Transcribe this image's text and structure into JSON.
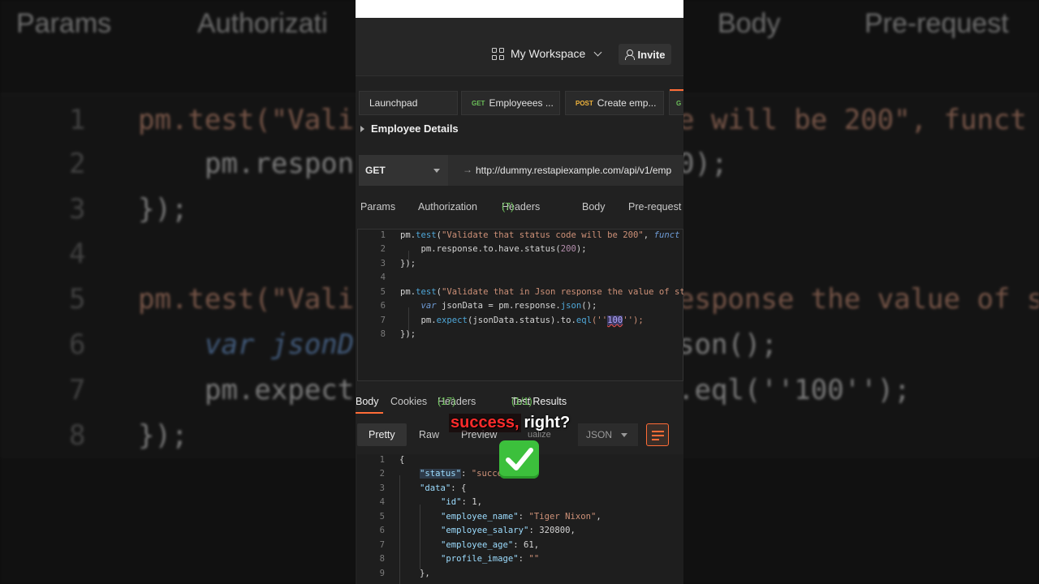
{
  "background": {
    "tabs": [
      "Params",
      "Authorizati",
      "Body",
      "Pre-request"
    ],
    "lines": [
      {
        "num": "1",
        "left": "pm.test(\"Vali",
        "right": "e will be 200\", funct"
      },
      {
        "num": "2",
        "left": "pm.respon",
        "right": "0);"
      },
      {
        "num": "3",
        "left": "});",
        "right": ""
      },
      {
        "num": "4",
        "left": "",
        "right": ""
      },
      {
        "num": "5",
        "left": "pm.test(\"Vali",
        "right": "esponse the value of st"
      },
      {
        "num": "6",
        "left": "var jsonD",
        "right": "son();"
      },
      {
        "num": "7",
        "left": "pm.expect",
        "right": ".eql(''100'');"
      },
      {
        "num": "8",
        "left": "});",
        "right": ""
      }
    ]
  },
  "header": {
    "workspace": "My Workspace",
    "invite": "Invite"
  },
  "tabs": [
    {
      "method": "",
      "label": "Launchpad"
    },
    {
      "method": "GET",
      "label": "Employeees ..."
    },
    {
      "method": "POST",
      "label": "Create emp..."
    },
    {
      "method": "G",
      "label": ""
    }
  ],
  "request": {
    "name": "Employee Details",
    "method": "GET",
    "url": "http://dummy.restapiexample.com/api/v1/emp"
  },
  "request_tabs": {
    "params": "Params",
    "authorization": "Authorization",
    "headers": "Headers",
    "headers_count": "(7)",
    "body": "Body",
    "prerequest": "Pre-request"
  },
  "editor": {
    "line_numbers": [
      "1",
      "2",
      "3",
      "4",
      "5",
      "6",
      "7",
      "8"
    ],
    "l1a": "pm.",
    "l1b": "test",
    "l1c": "(",
    "l1d": "\"Validate that status code will be 200\"",
    "l1e": ", ",
    "l1f": "funct",
    "l2a": "    pm.response.to.have.status(",
    "l2b": "200",
    "l2c": ");",
    "l3": "});",
    "l5a": "pm.",
    "l5b": "test",
    "l5c": "(",
    "l5d": "\"Validate that in Json response the value of st",
    "l6a": "    ",
    "l6b": "var",
    "l6c": " jsonData = pm.response.",
    "l6d": "json",
    "l6e": "();",
    "l7a": "    pm.",
    "l7b": "expect",
    "l7c": "(jsonData.status).to.",
    "l7d": "eql",
    "l7e": "(''",
    "l7f": "100",
    "l7g": "'');",
    "l8": "});"
  },
  "response_tabs": {
    "body": "Body",
    "cookies": "Cookies",
    "headers": "Headers",
    "headers_count": "(17)",
    "tests": "Test Results",
    "tests_count": "(1/1)"
  },
  "format_bar": {
    "pretty": "Pretty",
    "raw": "Raw",
    "preview": "Preview",
    "visualize": "ualize",
    "format": "JSON"
  },
  "response": {
    "line_numbers": [
      "1",
      "2",
      "3",
      "4",
      "5",
      "6",
      "7",
      "8",
      "9"
    ],
    "l1": "{",
    "l2k": "\"status\"",
    "l2v": "\"succe",
    "l3k": "\"data\"",
    "l3v": ": {",
    "l4k": "\"id\"",
    "l4v": ": 1,",
    "l5k": "\"employee_name\"",
    "l5v": "\"Tiger Nixon\"",
    "l6k": "\"employee_salary\"",
    "l6v": ": 320800,",
    "l7k": "\"employee_age\"",
    "l7v": ": 61,",
    "l8k": "\"profile_image\"",
    "l8v": "\"\"",
    "l9": "},"
  },
  "caption": {
    "highlight": "success,",
    "rest": "right?",
    "emoji": "check-mark-emoji"
  },
  "colors": {
    "accent": "#ff6c37",
    "get": "#6bbf59",
    "post": "#f0b43c",
    "caption_red": "#ff2b2b",
    "check_green": "#3cc03c"
  }
}
